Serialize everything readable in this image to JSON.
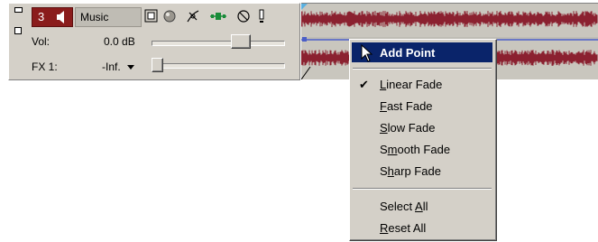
{
  "track": {
    "number": "3",
    "name": "Music",
    "volume_label": "Vol:",
    "volume_value": "0.0 dB",
    "volume_level": 0.7,
    "fx_label": "FX 1:",
    "fx_value": "-Inf.",
    "fx_level": 0.0
  },
  "icons": {
    "speaker": "speaker-icon",
    "track_fx": "track-fx-icon",
    "record_arm": "record-arm-icon",
    "envelope": "envelope-icon",
    "automation": "automation-icon",
    "bypass": "bypass-icon",
    "solo": "solo-icon"
  },
  "colors": {
    "track_number_bg": "#8a1c1c",
    "waveform": "#8b2130",
    "envelope_line": "#4a5ec8",
    "menu_highlight": "#0a246a"
  },
  "context_menu": {
    "add_point": "Add Point",
    "items": [
      {
        "pre": "",
        "u": "L",
        "post": "inear Fade",
        "checked": true
      },
      {
        "pre": "",
        "u": "F",
        "post": "ast Fade",
        "checked": false
      },
      {
        "pre": "",
        "u": "S",
        "post": "low Fade",
        "checked": false
      },
      {
        "pre": "S",
        "u": "m",
        "post": "ooth Fade",
        "checked": false
      },
      {
        "pre": "S",
        "u": "h",
        "post": "arp Fade",
        "checked": false
      }
    ],
    "select_all": {
      "pre": "Select ",
      "u": "A",
      "post": "ll"
    },
    "reset_all": {
      "pre": "",
      "u": "R",
      "post": "eset All"
    }
  }
}
